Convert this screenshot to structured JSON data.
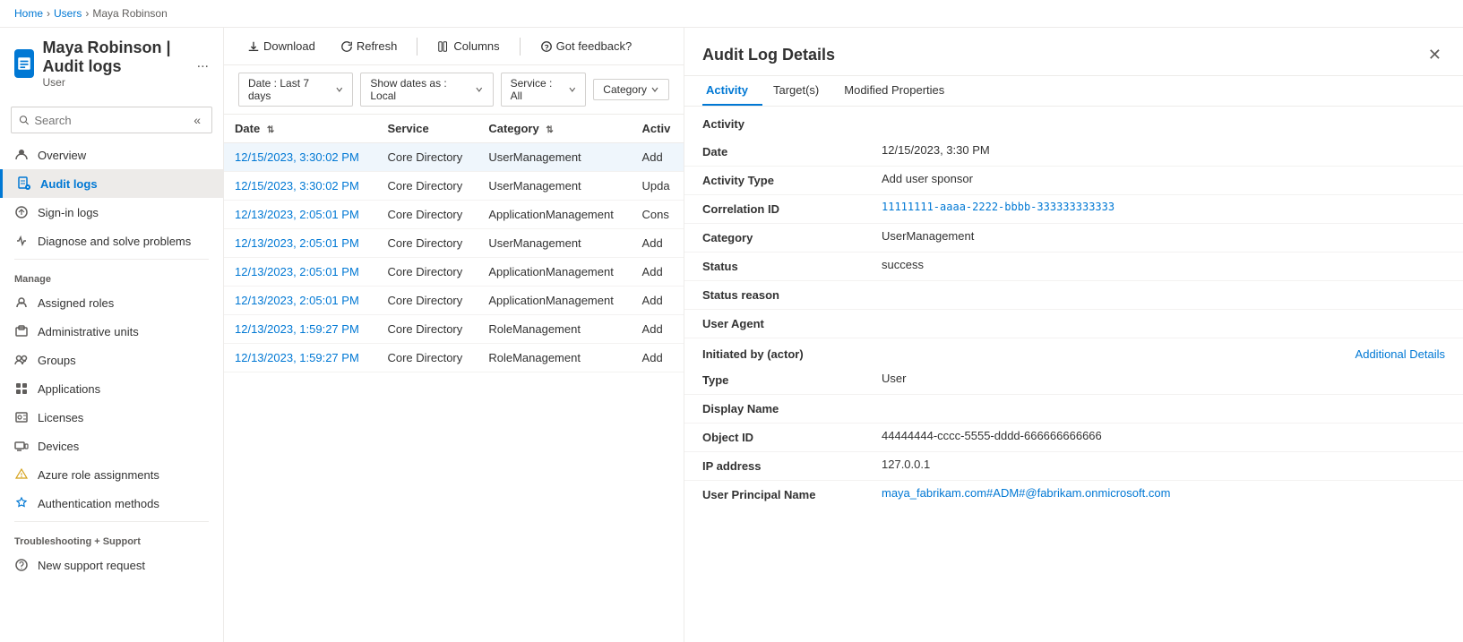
{
  "breadcrumb": {
    "items": [
      "Home",
      "Users",
      "Maya Robinson"
    ]
  },
  "page": {
    "title": "Maya Robinson | Audit logs",
    "subtitle": "User",
    "ellipsis": "..."
  },
  "sidebar": {
    "search_placeholder": "Search",
    "collapse_label": "«",
    "nav_items": [
      {
        "id": "overview",
        "label": "Overview",
        "icon": "person"
      },
      {
        "id": "audit-logs",
        "label": "Audit logs",
        "icon": "audit",
        "active": true
      },
      {
        "id": "sign-in-logs",
        "label": "Sign-in logs",
        "icon": "signin"
      },
      {
        "id": "diagnose",
        "label": "Diagnose and solve problems",
        "icon": "diagnose"
      }
    ],
    "manage_label": "Manage",
    "manage_items": [
      {
        "id": "assigned-roles",
        "label": "Assigned roles",
        "icon": "roles"
      },
      {
        "id": "admin-units",
        "label": "Administrative units",
        "icon": "admin"
      },
      {
        "id": "groups",
        "label": "Groups",
        "icon": "groups"
      },
      {
        "id": "applications",
        "label": "Applications",
        "icon": "apps"
      },
      {
        "id": "licenses",
        "label": "Licenses",
        "icon": "licenses"
      },
      {
        "id": "devices",
        "label": "Devices",
        "icon": "devices"
      },
      {
        "id": "azure-role",
        "label": "Azure role assignments",
        "icon": "azure"
      },
      {
        "id": "auth-methods",
        "label": "Authentication methods",
        "icon": "auth"
      }
    ],
    "troubleshooting_label": "Troubleshooting + Support",
    "support_items": [
      {
        "id": "new-support",
        "label": "New support request",
        "icon": "support"
      }
    ]
  },
  "toolbar": {
    "download_label": "Download",
    "refresh_label": "Refresh",
    "columns_label": "Columns",
    "feedback_label": "Got feedback?"
  },
  "filters": {
    "date_filter": "Date : Last 7 days",
    "show_dates_filter": "Show dates as : Local",
    "service_filter": "Service : All",
    "category_filter": "Category"
  },
  "table": {
    "columns": [
      {
        "id": "date",
        "label": "Date",
        "sortable": true
      },
      {
        "id": "service",
        "label": "Service",
        "sortable": false
      },
      {
        "id": "category",
        "label": "Category",
        "sortable": true
      },
      {
        "id": "activity",
        "label": "Activ",
        "sortable": false
      }
    ],
    "rows": [
      {
        "date": "12/15/2023, 3:30:02 PM",
        "service": "Core Directory",
        "category": "UserManagement",
        "activity": "Add",
        "selected": true
      },
      {
        "date": "12/15/2023, 3:30:02 PM",
        "service": "Core Directory",
        "category": "UserManagement",
        "activity": "Upda",
        "selected": false
      },
      {
        "date": "12/13/2023, 2:05:01 PM",
        "service": "Core Directory",
        "category": "ApplicationManagement",
        "activity": "Cons",
        "selected": false
      },
      {
        "date": "12/13/2023, 2:05:01 PM",
        "service": "Core Directory",
        "category": "UserManagement",
        "activity": "Add",
        "selected": false
      },
      {
        "date": "12/13/2023, 2:05:01 PM",
        "service": "Core Directory",
        "category": "ApplicationManagement",
        "activity": "Add",
        "selected": false
      },
      {
        "date": "12/13/2023, 2:05:01 PM",
        "service": "Core Directory",
        "category": "ApplicationManagement",
        "activity": "Add",
        "selected": false
      },
      {
        "date": "12/13/2023, 1:59:27 PM",
        "service": "Core Directory",
        "category": "RoleManagement",
        "activity": "Add",
        "selected": false
      },
      {
        "date": "12/13/2023, 1:59:27 PM",
        "service": "Core Directory",
        "category": "RoleManagement",
        "activity": "Add",
        "selected": false
      }
    ]
  },
  "detail_panel": {
    "title": "Audit Log Details",
    "tabs": [
      {
        "id": "activity",
        "label": "Activity",
        "active": true
      },
      {
        "id": "targets",
        "label": "Target(s)",
        "active": false
      },
      {
        "id": "modified-properties",
        "label": "Modified Properties",
        "active": false
      }
    ],
    "activity_section_title": "Activity",
    "fields": [
      {
        "label": "Date",
        "value": "12/15/2023, 3:30 PM",
        "type": "text"
      },
      {
        "label": "Activity Type",
        "value": "Add user sponsor",
        "type": "text"
      },
      {
        "label": "Correlation ID",
        "value": "11111111-aaaa-2222-bbbb-333333333333",
        "type": "mono"
      },
      {
        "label": "Category",
        "value": "UserManagement",
        "type": "text"
      },
      {
        "label": "Status",
        "value": "success",
        "type": "text"
      },
      {
        "label": "Status reason",
        "value": "",
        "type": "text"
      },
      {
        "label": "User Agent",
        "value": "",
        "type": "text"
      }
    ],
    "actor_section_title": "Initiated by (actor)",
    "additional_details_label": "Additional Details",
    "actor_fields": [
      {
        "label": "Type",
        "value": "User",
        "type": "text"
      },
      {
        "label": "Display Name",
        "value": "",
        "type": "text"
      },
      {
        "label": "Object ID",
        "value": "44444444-cccc-5555-dddd-666666666666",
        "type": "text"
      },
      {
        "label": "IP address",
        "value": "127.0.0.1",
        "type": "text"
      },
      {
        "label": "User Principal Name",
        "value": "maya_fabrikam.com#ADM#@fabrikam.onmicrosoft.com",
        "type": "link"
      }
    ]
  },
  "colors": {
    "primary": "#0078d4",
    "border": "#edebe9",
    "bg_active": "#edebe9",
    "text_secondary": "#605e5c"
  }
}
